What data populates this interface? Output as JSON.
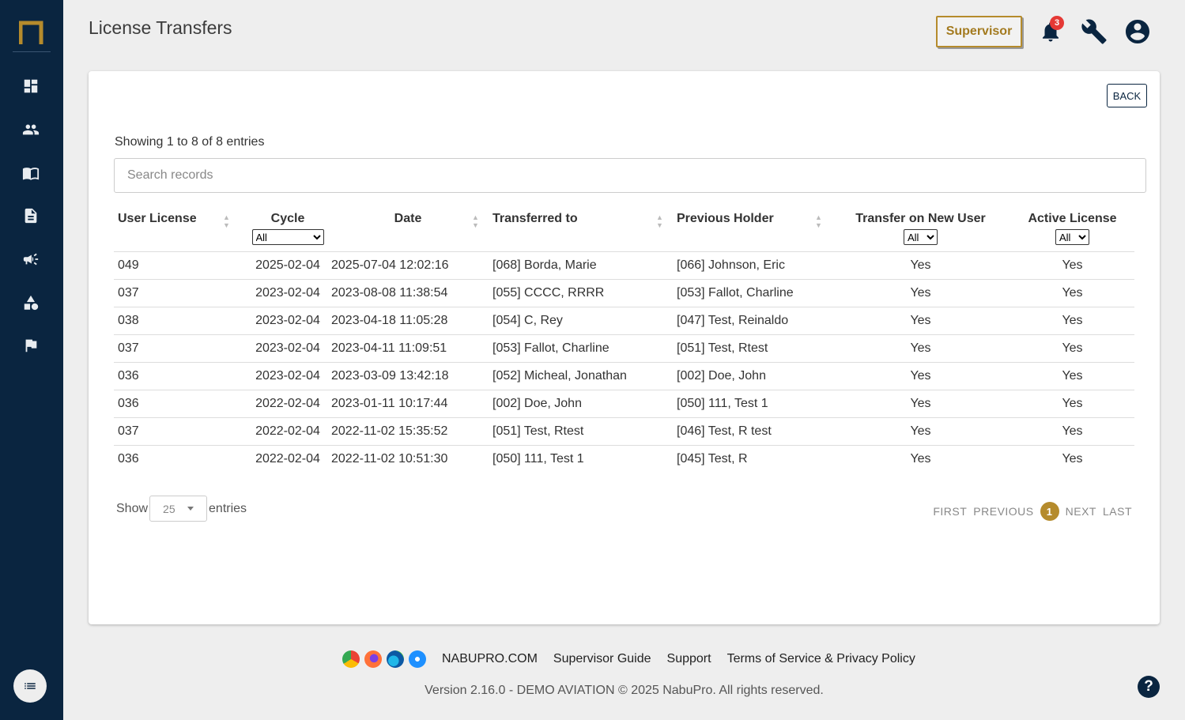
{
  "header": {
    "title": "License Transfers",
    "role_button": "Supervisor",
    "notification_count": "3"
  },
  "sidebar": {
    "items": [
      {
        "name": "dashboard-icon"
      },
      {
        "name": "users-icon"
      },
      {
        "name": "book-icon"
      },
      {
        "name": "document-icon"
      },
      {
        "name": "megaphone-icon"
      },
      {
        "name": "shapes-icon"
      },
      {
        "name": "flag-icon"
      }
    ]
  },
  "card": {
    "back_label": "BACK",
    "showing_text": "Showing 1 to 8 of 8 entries",
    "search_placeholder": "Search records"
  },
  "table": {
    "columns": [
      "User License",
      "Cycle",
      "Date",
      "Transferred to",
      "Previous Holder",
      "Transfer on New User",
      "Active License"
    ],
    "filters": {
      "cycle": "All",
      "transfer_on_new_user": "All",
      "active_license": "All"
    },
    "rows": [
      [
        "049",
        "2025-02-04",
        "2025-07-04 12:02:16",
        "[068] Borda, Marie",
        "[066] Johnson, Eric",
        "Yes",
        "Yes"
      ],
      [
        "037",
        "2023-02-04",
        "2023-08-08 11:38:54",
        "[055] CCCC, RRRR",
        "[053] Fallot, Charline",
        "Yes",
        "Yes"
      ],
      [
        "038",
        "2023-02-04",
        "2023-04-18 11:05:28",
        "[054] C, Rey",
        "[047] Test, Reinaldo",
        "Yes",
        "Yes"
      ],
      [
        "037",
        "2023-02-04",
        "2023-04-11 11:09:51",
        "[053] Fallot, Charline",
        "[051] Test, Rtest",
        "Yes",
        "Yes"
      ],
      [
        "036",
        "2023-02-04",
        "2023-03-09 13:42:18",
        "[052] Micheal, Jonathan",
        "[002] Doe, John",
        "Yes",
        "Yes"
      ],
      [
        "036",
        "2022-02-04",
        "2023-01-11 10:17:44",
        "[002] Doe, John",
        "[050] 111, Test 1",
        "Yes",
        "Yes"
      ],
      [
        "037",
        "2022-02-04",
        "2022-11-02 15:35:52",
        "[051] Test, Rtest",
        "[046] Test, R test",
        "Yes",
        "Yes"
      ],
      [
        "036",
        "2022-02-04",
        "2022-11-02 10:51:30",
        "[050] 111, Test 1",
        "[045] Test, R",
        "Yes",
        "Yes"
      ]
    ]
  },
  "pagination": {
    "show_label": "Show",
    "entries_value": "25",
    "entries_label": "entries",
    "first": "FIRST",
    "previous": "PREVIOUS",
    "current": "1",
    "next": "NEXT",
    "last": "LAST"
  },
  "footer": {
    "links": [
      "NABUPRO.COM",
      "Supervisor Guide",
      "Support",
      "Terms of Service & Privacy Policy"
    ],
    "version": "Version 2.16.0 - DEMO AVIATION © 2025 NabuPro. All rights reserved."
  },
  "colors": {
    "sidebar": "#0a2540",
    "accent": "#b58b2c",
    "badge": "#e53935"
  }
}
